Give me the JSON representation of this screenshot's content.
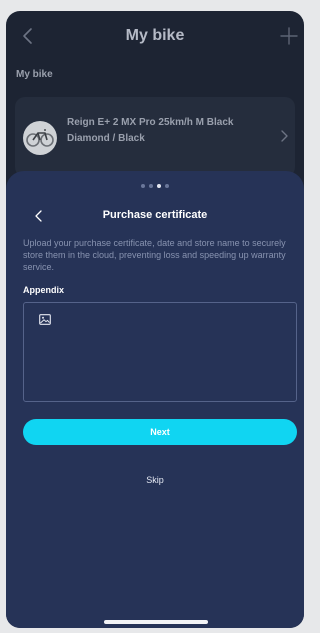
{
  "header": {
    "title": "My bike",
    "back_icon": "chevron-left-icon",
    "add_icon": "plus-icon"
  },
  "section": {
    "label": "My bike"
  },
  "bike": {
    "name": "Reign E+ 2 MX Pro 25km/h M Black Diamond / Black",
    "thumbnail_icon": "bicycle-icon"
  },
  "sheet": {
    "step_total": 4,
    "step_active": 3,
    "title": "Purchase certificate",
    "description": "Upload your purchase certificate, date and store name to securely store them in the cloud, preventing loss and speeding up warranty service.",
    "appendix_label": "Appendix",
    "upload_icon": "image-icon",
    "next_label": "Next",
    "skip_label": "Skip"
  },
  "colors": {
    "background": "#1d2433",
    "sheet": "#263357",
    "accent": "#10d5f2"
  }
}
